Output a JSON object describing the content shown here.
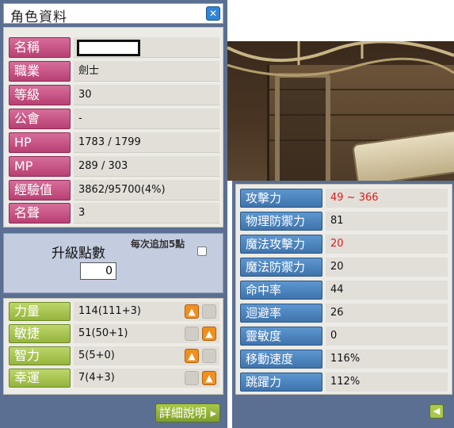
{
  "window": {
    "title": "角色資料"
  },
  "info": [
    {
      "label": "名稱",
      "value": ""
    },
    {
      "label": "職業",
      "value": "劍士"
    },
    {
      "label": "等級",
      "value": "30"
    },
    {
      "label": "公會",
      "value": "-"
    },
    {
      "label": "HP",
      "value": "1783 / 1799"
    },
    {
      "label": "MP",
      "value": "289 / 303"
    },
    {
      "label": "經驗值",
      "value": "3862/95700(4%)"
    },
    {
      "label": "名聲",
      "value": "3"
    }
  ],
  "levelup": {
    "ap_label": "升級點數",
    "ap_value": "0",
    "auto_label": "每次追加5點",
    "auto_checked": false
  },
  "stats": [
    {
      "label": "力量",
      "value": "114(111+3)",
      "up_enabled": true
    },
    {
      "label": "敏捷",
      "value": "51(50+1)",
      "up_enabled": true
    },
    {
      "label": "智力",
      "value": "5(5+0)",
      "up_enabled": true
    },
    {
      "label": "幸運",
      "value": "7(4+3)",
      "up_enabled": true
    }
  ],
  "details_button": "詳細說明",
  "attributes": [
    {
      "label": "攻擊力",
      "value": "49 ~ 366",
      "highlight": true
    },
    {
      "label": "物理防禦力",
      "value": "81",
      "highlight": false
    },
    {
      "label": "魔法攻擊力",
      "value": "20",
      "highlight": true
    },
    {
      "label": "魔法防禦力",
      "value": "20",
      "highlight": false
    },
    {
      "label": "命中率",
      "value": "44",
      "highlight": false
    },
    {
      "label": "迴避率",
      "value": "26",
      "highlight": false
    },
    {
      "label": "靈敏度",
      "value": "0",
      "highlight": false
    },
    {
      "label": "移動速度",
      "value": "116%",
      "highlight": false
    },
    {
      "label": "跳躍力",
      "value": "112%",
      "highlight": false
    }
  ],
  "colors": {
    "frame": "#5b6f92",
    "info_label": "#b83f73",
    "stat_label": "#95b43d",
    "attr_label": "#3f74ad",
    "highlight_value": "#e01b1b",
    "up_button": "#ef8f1e"
  }
}
